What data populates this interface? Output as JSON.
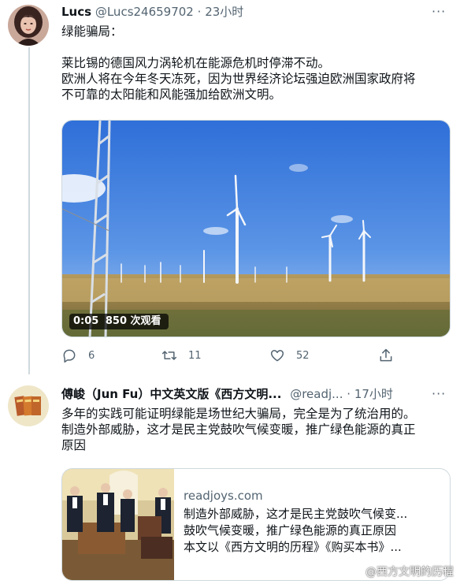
{
  "tweet1": {
    "display_name": "Lucs",
    "handle": "@Lucs24659702",
    "separator": "·",
    "time": "23小时",
    "more": "···",
    "lines": [
      "绿能骗局：",
      "",
      "莱比锡的德国风力涡轮机在能源危机时停滞不动。",
      "欧洲人将在今年冬天冻死，因为世界经济论坛强迫欧洲国家政府将",
      "不可靠的太阳能和风能强加给欧洲文明。"
    ],
    "video": {
      "duration": "0:05",
      "views": "850 次观看"
    },
    "actions": {
      "replies": "6",
      "retweets": "11",
      "likes": "52",
      "share": ""
    }
  },
  "tweet2": {
    "display_name": "傅峻（Jun Fu）中文英文版《西方文明...",
    "handle": "@readj...",
    "separator": "·",
    "time": "17小时",
    "more": "···",
    "lines": [
      "多年的实践可能证明绿能是场世纪大骗局，完全是为了统治用的。",
      "制造外部威胁，这才是民主党鼓吹气候变暖，推广绿色能源的真正",
      "原因"
    ],
    "card": {
      "domain": "readjoys.com",
      "title": "制造外部威胁，这才是民主党鼓吹气候变...",
      "desc1": "鼓吹气候变暖，推广绿色能源的真正原因",
      "desc2": "本文以《西方文明的历程》《购买本书》..."
    }
  },
  "watermark": "@西方文明的历程"
}
